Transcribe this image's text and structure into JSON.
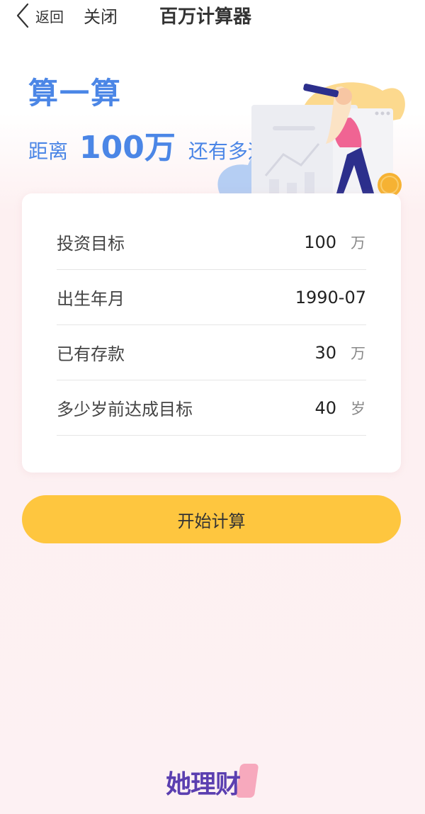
{
  "nav": {
    "back_label": "返回",
    "close_label": "关闭",
    "title": "百万计算器"
  },
  "hero": {
    "title": "算一算",
    "subtitle_prefix": "距离",
    "subtitle_amount": "100万",
    "subtitle_suffix": "还有多远?"
  },
  "form": {
    "rows": [
      {
        "label": "投资目标",
        "value": "100",
        "unit": "万"
      },
      {
        "label": "出生年月",
        "value": "1990-07",
        "unit": ""
      },
      {
        "label": "已有存款",
        "value": "30",
        "unit": "万"
      },
      {
        "label": "多少岁前达成目标",
        "value": "40",
        "unit": "岁"
      }
    ]
  },
  "actions": {
    "start_label": "开始计算"
  },
  "footer": {
    "brand": "她理财"
  },
  "colors": {
    "accent_blue": "#4b86e6",
    "button_yellow": "#fec63f",
    "brand_purple": "#5b3fb0",
    "brand_pink": "#f7a9bd"
  }
}
